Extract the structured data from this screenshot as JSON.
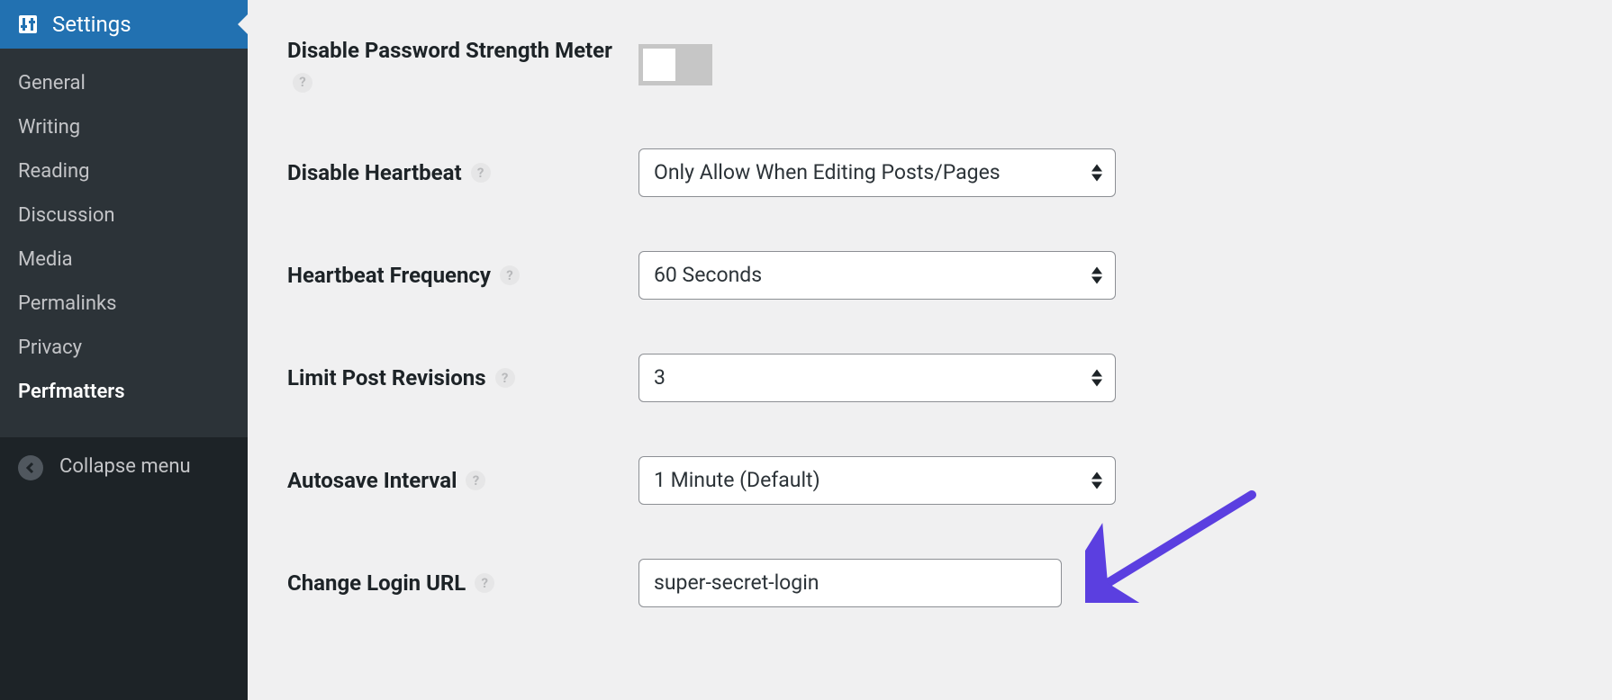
{
  "sidebar": {
    "header_label": "Settings",
    "items": [
      {
        "label": "General"
      },
      {
        "label": "Writing"
      },
      {
        "label": "Reading"
      },
      {
        "label": "Discussion"
      },
      {
        "label": "Media"
      },
      {
        "label": "Permalinks"
      },
      {
        "label": "Privacy"
      },
      {
        "label": "Perfmatters"
      }
    ],
    "collapse_label": "Collapse menu"
  },
  "help_glyph": "?",
  "settings": {
    "disable_password_strength_meter": {
      "label": "Disable Password Strength Meter",
      "value": false
    },
    "disable_heartbeat": {
      "label": "Disable Heartbeat",
      "value": "Only Allow When Editing Posts/Pages"
    },
    "heartbeat_frequency": {
      "label": "Heartbeat Frequency",
      "value": "60 Seconds"
    },
    "limit_post_revisions": {
      "label": "Limit Post Revisions",
      "value": "3"
    },
    "autosave_interval": {
      "label": "Autosave Interval",
      "value": "1 Minute (Default)"
    },
    "change_login_url": {
      "label": "Change Login URL",
      "value": "super-secret-login"
    }
  }
}
